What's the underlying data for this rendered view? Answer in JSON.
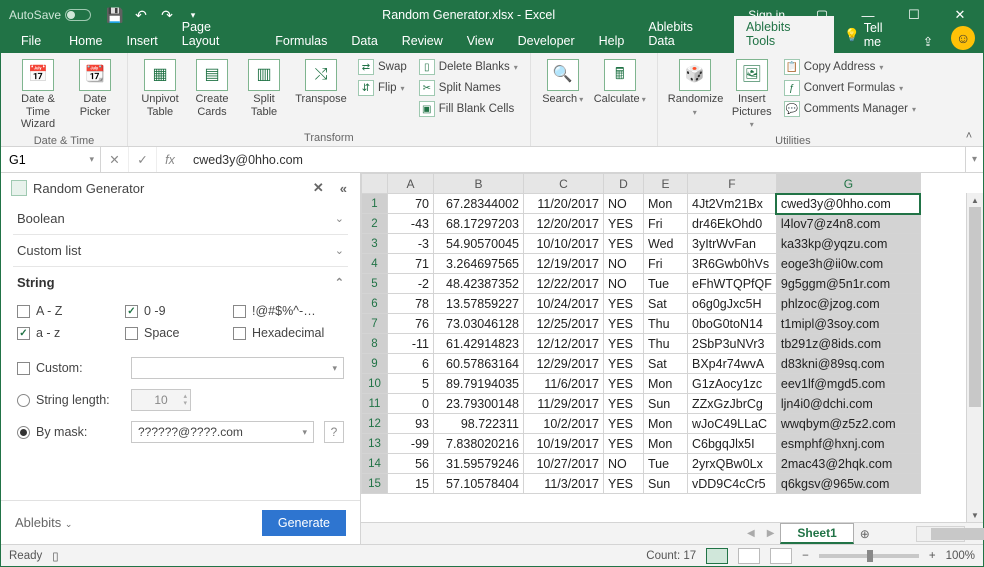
{
  "window": {
    "autosave": "AutoSave",
    "title": "Random Generator.xlsx - Excel",
    "signin": "Sign in"
  },
  "tabs": {
    "file": "File",
    "list": [
      "Home",
      "Insert",
      "Page Layout",
      "Formulas",
      "Data",
      "Review",
      "View",
      "Developer",
      "Help",
      "Ablebits Data",
      "Ablebits Tools"
    ],
    "active": "Ablebits Tools",
    "tellme": "Tell me"
  },
  "ribbon": {
    "g1": {
      "label": "Date & Time",
      "b1": "Date & Time Wizard",
      "b2": "Date Picker"
    },
    "g2": {
      "label": "Transform",
      "b1": "Unpivot Table",
      "b2": "Create Cards",
      "b3": "Split Table",
      "b4": "Transpose",
      "s1": "Swap",
      "s2": "Flip",
      "s3": "Delete Blanks",
      "s4": "Split Names",
      "s5": "Fill Blank Cells"
    },
    "g3": {
      "b1": "Search",
      "b2": "Calculate"
    },
    "g4": {
      "label": "Utilities",
      "b1": "Randomize",
      "b2": "Insert Pictures",
      "s1": "Copy Address",
      "s2": "Convert Formulas",
      "s3": "Comments Manager"
    }
  },
  "fbar": {
    "name": "G1",
    "fx": "fx",
    "value": "cwed3y@0hho.com"
  },
  "pane": {
    "title": "Random Generator",
    "sec_boolean": "Boolean",
    "sec_custom": "Custom list",
    "sec_string": "String",
    "chk_AZ": "A - Z",
    "chk_09": "0 -9",
    "chk_sym": "!@#$%^-…",
    "chk_az": "a - z",
    "chk_space": "Space",
    "chk_hex": "Hexadecimal",
    "custom": "Custom:",
    "strlen": "String length:",
    "strlen_val": "10",
    "bymask": "By mask:",
    "mask_val": "??????@????.com",
    "brand": "Ablebits",
    "generate": "Generate"
  },
  "gridmeta": {
    "cols": [
      "",
      "A",
      "B",
      "C",
      "D",
      "E",
      "F",
      "G"
    ]
  },
  "rows": [
    {
      "n": 1,
      "A": "70",
      "B": "67.28344002",
      "C": "11/20/2017",
      "D": "NO",
      "E": "Mon",
      "F": "4Jt2Vm21Bx",
      "G": "cwed3y@0hho.com"
    },
    {
      "n": 2,
      "A": "-43",
      "B": "68.17297203",
      "C": "12/20/2017",
      "D": "YES",
      "E": "Fri",
      "F": "dr46EkOhd0",
      "G": "l4lov7@z4n8.com"
    },
    {
      "n": 3,
      "A": "-3",
      "B": "54.90570045",
      "C": "10/10/2017",
      "D": "YES",
      "E": "Wed",
      "F": "3yItrWvFan",
      "G": "ka33kp@yqzu.com"
    },
    {
      "n": 4,
      "A": "71",
      "B": "3.264697565",
      "C": "12/19/2017",
      "D": "NO",
      "E": "Fri",
      "F": "3R6Gwb0hVs",
      "G": "eoge3h@ii0w.com"
    },
    {
      "n": 5,
      "A": "-2",
      "B": "48.42387352",
      "C": "12/22/2017",
      "D": "NO",
      "E": "Tue",
      "F": "eFhWTQPfQF",
      "G": "9g5ggm@5n1r.com"
    },
    {
      "n": 6,
      "A": "78",
      "B": "13.57859227",
      "C": "10/24/2017",
      "D": "YES",
      "E": "Sat",
      "F": "o6g0gJxc5H",
      "G": "phlzoc@jzog.com"
    },
    {
      "n": 7,
      "A": "76",
      "B": "73.03046128",
      "C": "12/25/2017",
      "D": "YES",
      "E": "Thu",
      "F": "0boG0toN14",
      "G": "t1mipl@3soy.com"
    },
    {
      "n": 8,
      "A": "-11",
      "B": "61.42914823",
      "C": "12/12/2017",
      "D": "YES",
      "E": "Thu",
      "F": "2SbP3uNVr3",
      "G": "tb291z@8ids.com"
    },
    {
      "n": 9,
      "A": "6",
      "B": "60.57863164",
      "C": "12/29/2017",
      "D": "YES",
      "E": "Sat",
      "F": "BXp4r74wvA",
      "G": "d83kni@89sq.com"
    },
    {
      "n": 10,
      "A": "5",
      "B": "89.79194035",
      "C": "11/6/2017",
      "D": "YES",
      "E": "Mon",
      "F": "G1zAocy1zc",
      "G": "eev1lf@mgd5.com"
    },
    {
      "n": 11,
      "A": "0",
      "B": "23.79300148",
      "C": "11/29/2017",
      "D": "YES",
      "E": "Sun",
      "F": "ZZxGzJbrCg",
      "G": "ljn4i0@dchi.com"
    },
    {
      "n": 12,
      "A": "93",
      "B": "98.722311",
      "C": "10/2/2017",
      "D": "YES",
      "E": "Mon",
      "F": "wJoC49LLaC",
      "G": "wwqbym@z5z2.com"
    },
    {
      "n": 13,
      "A": "-99",
      "B": "7.838020216",
      "C": "10/19/2017",
      "D": "YES",
      "E": "Mon",
      "F": "C6bgqJlx5I",
      "G": "esmphf@hxnj.com"
    },
    {
      "n": 14,
      "A": "56",
      "B": "31.59579246",
      "C": "10/27/2017",
      "D": "NO",
      "E": "Tue",
      "F": "2yrxQBw0Lx",
      "G": "2mac43@2hqk.com"
    },
    {
      "n": 15,
      "A": "15",
      "B": "57.10578404",
      "C": "11/3/2017",
      "D": "YES",
      "E": "Sun",
      "F": "vDD9C4cCr5",
      "G": "q6kgsv@965w.com"
    }
  ],
  "sheet": {
    "name": "Sheet1"
  },
  "status": {
    "ready": "Ready",
    "count": "Count: 17",
    "zoom": "100%"
  }
}
